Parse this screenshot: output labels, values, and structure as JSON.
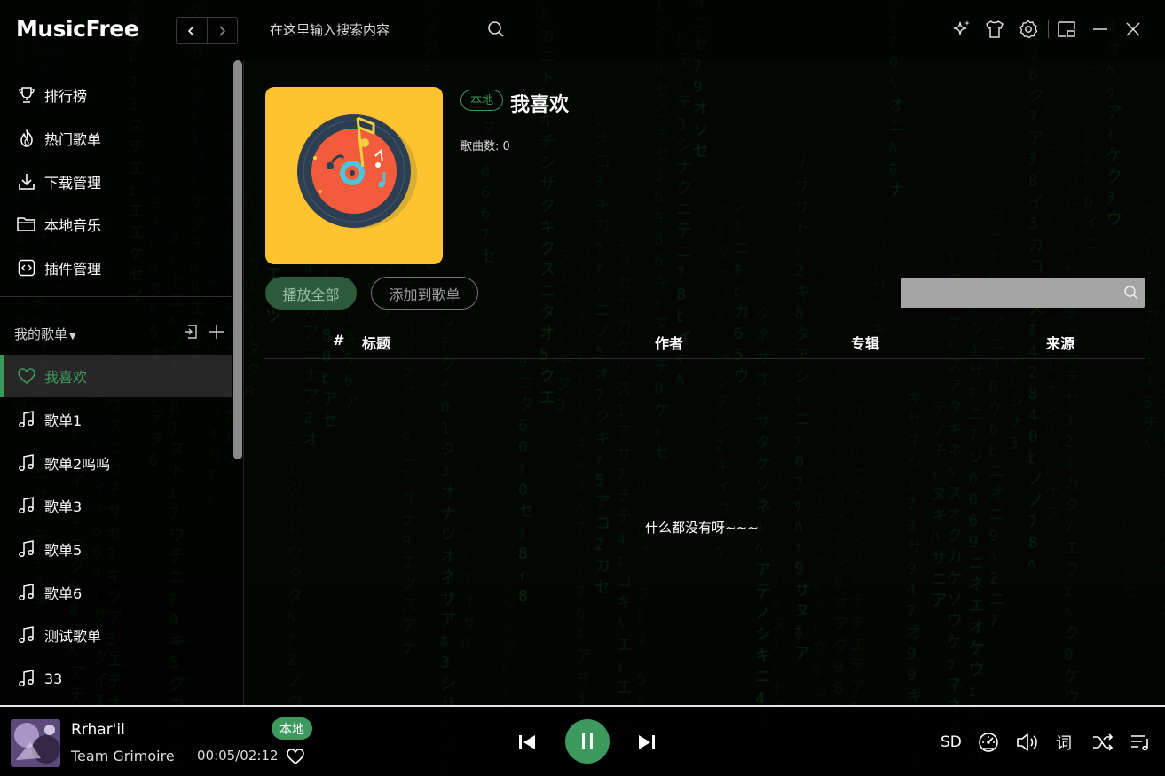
{
  "app": {
    "name": "MusicFree"
  },
  "search": {
    "placeholder": "在这里输入搜索内容"
  },
  "sidebar": {
    "nav": [
      {
        "label": "排行榜",
        "icon": "trophy-icon"
      },
      {
        "label": "热门歌单",
        "icon": "fire-icon"
      },
      {
        "label": "下载管理",
        "icon": "download-icon"
      },
      {
        "label": "本地音乐",
        "icon": "folder-icon"
      },
      {
        "label": "插件管理",
        "icon": "plugin-icon"
      }
    ],
    "my_header": "我的歌单",
    "playlists": [
      {
        "label": "我喜欢",
        "icon": "heart-icon",
        "active": true
      },
      {
        "label": "歌单1",
        "icon": "music-note-icon"
      },
      {
        "label": "歌单2呜呜",
        "icon": "music-note-icon"
      },
      {
        "label": "歌单3",
        "icon": "music-note-icon"
      },
      {
        "label": "歌单5",
        "icon": "music-note-icon"
      },
      {
        "label": "歌单6",
        "icon": "music-note-icon"
      },
      {
        "label": "测试歌单",
        "icon": "music-note-icon"
      },
      {
        "label": "33",
        "icon": "music-note-icon"
      }
    ]
  },
  "playlist": {
    "badge": "本地",
    "title": "我喜欢",
    "song_count": "歌曲数: 0",
    "play_all": "播放全部",
    "add_to": "添加到歌单",
    "columns": [
      "#",
      "标题",
      "作者",
      "专辑",
      "来源"
    ],
    "empty_text": "什么都没有呀~~~"
  },
  "player": {
    "title": "Rrhar'il",
    "artist": "Team Grimoire",
    "badge": "本地",
    "time": "00:05/02:12",
    "quality": "SD",
    "lyric": "词"
  },
  "colors": {
    "accent": "#3c9a5e",
    "cover_bg": "#fdc430"
  }
}
